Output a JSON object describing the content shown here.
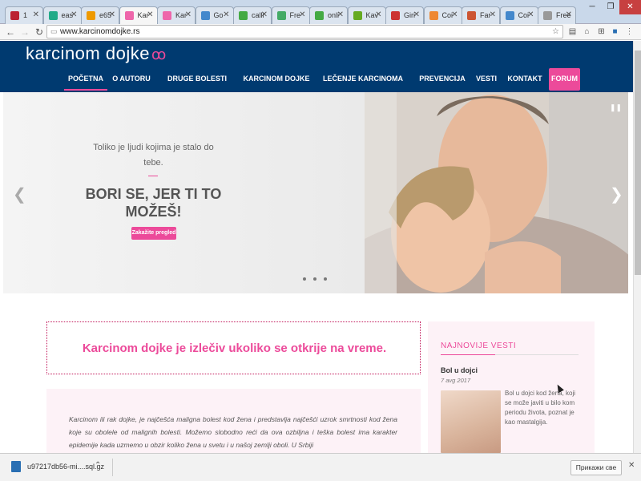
{
  "browser": {
    "tabs": [
      {
        "label": "1",
        "color": "#b23"
      },
      {
        "label": "eas",
        "color": "#2a8"
      },
      {
        "label": "e65",
        "color": "#e90"
      },
      {
        "label": "Kar",
        "color": "#e6a",
        "active": true
      },
      {
        "label": "Kar",
        "color": "#e6a"
      },
      {
        "label": "Go",
        "color": "#48c"
      },
      {
        "label": "calli",
        "color": "#4a4"
      },
      {
        "label": "Fre",
        "color": "#4a6"
      },
      {
        "label": "onli",
        "color": "#4a4"
      },
      {
        "label": "Kav",
        "color": "#6a2"
      },
      {
        "label": "Giri",
        "color": "#c33"
      },
      {
        "label": "Coi",
        "color": "#e83"
      },
      {
        "label": "Far",
        "color": "#c53"
      },
      {
        "label": "Coi",
        "color": "#48c"
      },
      {
        "label": "Free",
        "color": "#999"
      }
    ],
    "url": "www.karcinomdojke.rs"
  },
  "site": {
    "logo": "karcinom dojke",
    "nav": [
      {
        "label": "POČETNA",
        "active": true
      },
      {
        "label": "O AUTORU"
      },
      {
        "label": "DRUGE BOLESTI DOJKE"
      },
      {
        "label": "KARCINOM DOJKE"
      },
      {
        "label": "LEČENJE KARCINOMA DOJKE"
      },
      {
        "label": "PREVENCIJA"
      },
      {
        "label": "VESTI"
      },
      {
        "label": "KONTAKT"
      },
      {
        "label": "FORUM"
      }
    ],
    "hero": {
      "subtitle": "Toliko je ljudi kojima je stalo do tebe.",
      "title": "BORI SE, JER TI TO MOŽEŠ!",
      "cta": "Zakažite pregled",
      "slides_count": 3
    },
    "tagline": "Karcinom dojke je izlečiv ukoliko se otkrije na vreme.",
    "intro": "Karcinom ili rak dojke, je najčešća maligna bolest kod žena i predstavlja najčešći uzrok smrtnosti kod žena koje su obolele od malignih bolesti. Možemo slobodno reći da ova ozbiljna i teška bolest ima karakter epidemije kada uzmemo u obzir koliko žena u svetu i u našoj zemlji oboli. U Srbiji",
    "news": {
      "title": "NAJNOVIJE VESTI",
      "item": {
        "headline": "Bol u dojci",
        "date": "7 avg 2017",
        "text": "Bol u dojci kod žena, koji se može javiti u bilo kom periodu života, poznat je kao mastalgija."
      }
    }
  },
  "downloads": {
    "file": "u97217db56-mi....sql.gz",
    "show_all": "Прикажи све"
  },
  "colors": {
    "accent": "#ec4a9a",
    "header": "#003a70"
  }
}
